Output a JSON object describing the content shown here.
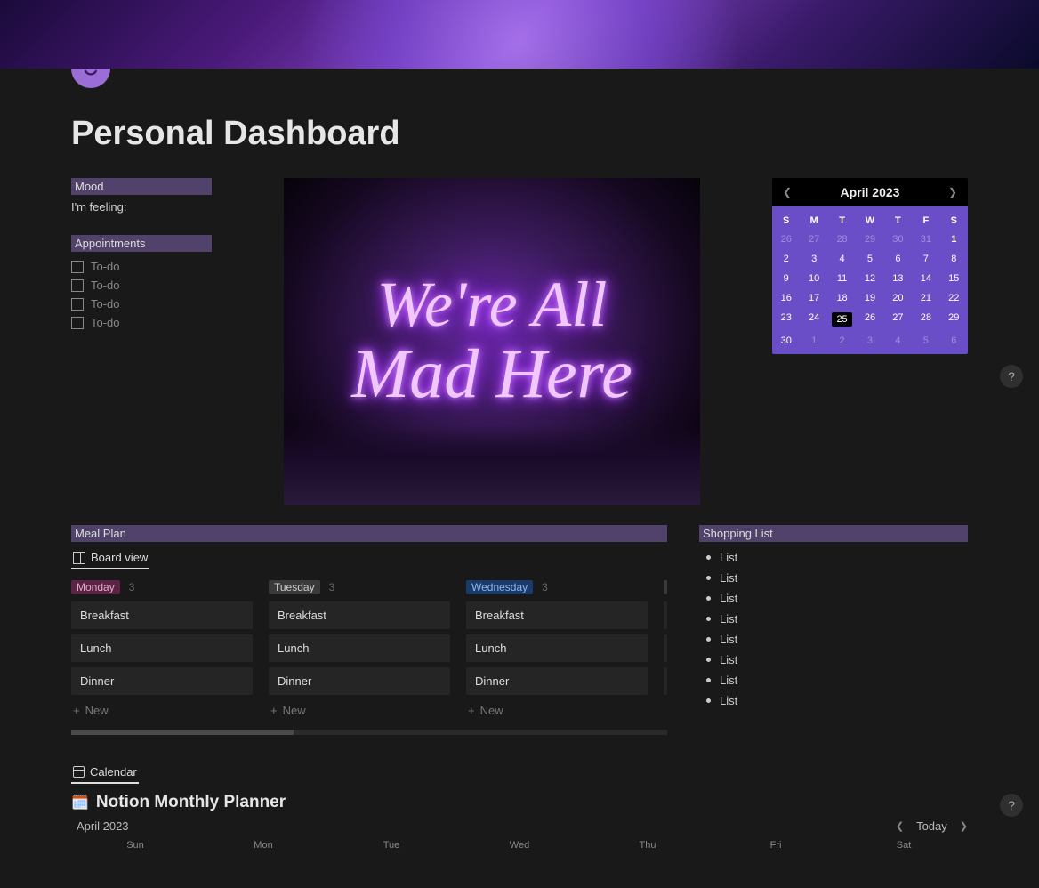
{
  "page": {
    "title": "Personal Dashboard",
    "help_label": "?"
  },
  "mood": {
    "heading": "Mood",
    "text": "I'm feeling:"
  },
  "appointments": {
    "heading": "Appointments",
    "items": [
      "To-do",
      "To-do",
      "To-do",
      "To-do"
    ]
  },
  "neon": {
    "line1": "We're All",
    "line2": "Mad Here"
  },
  "mini_calendar": {
    "title": "April 2023",
    "dow": [
      "S",
      "M",
      "T",
      "W",
      "T",
      "F",
      "S"
    ],
    "weeks": [
      [
        {
          "d": "26",
          "off": true
        },
        {
          "d": "27",
          "off": true
        },
        {
          "d": "28",
          "off": true
        },
        {
          "d": "29",
          "off": true
        },
        {
          "d": "30",
          "off": true
        },
        {
          "d": "31",
          "off": true
        },
        {
          "d": "1",
          "bold": true
        }
      ],
      [
        {
          "d": "2"
        },
        {
          "d": "3"
        },
        {
          "d": "4"
        },
        {
          "d": "5"
        },
        {
          "d": "6"
        },
        {
          "d": "7"
        },
        {
          "d": "8"
        }
      ],
      [
        {
          "d": "9"
        },
        {
          "d": "10"
        },
        {
          "d": "11"
        },
        {
          "d": "12"
        },
        {
          "d": "13"
        },
        {
          "d": "14"
        },
        {
          "d": "15"
        }
      ],
      [
        {
          "d": "16"
        },
        {
          "d": "17"
        },
        {
          "d": "18"
        },
        {
          "d": "19"
        },
        {
          "d": "20"
        },
        {
          "d": "21"
        },
        {
          "d": "22"
        }
      ],
      [
        {
          "d": "23"
        },
        {
          "d": "24"
        },
        {
          "d": "25",
          "sel": true
        },
        {
          "d": "26"
        },
        {
          "d": "27"
        },
        {
          "d": "28"
        },
        {
          "d": "29"
        }
      ],
      [
        {
          "d": "30"
        },
        {
          "d": "1",
          "off": true
        },
        {
          "d": "2",
          "off": true
        },
        {
          "d": "3",
          "off": true
        },
        {
          "d": "4",
          "off": true
        },
        {
          "d": "5",
          "off": true
        },
        {
          "d": "6",
          "off": true
        }
      ]
    ]
  },
  "meal_plan": {
    "heading": "Meal Plan",
    "view_label": "Board view",
    "new_label": "New",
    "columns": [
      {
        "tag": "Monday",
        "cls": "mon",
        "count": "3",
        "cards": [
          "Breakfast",
          "Lunch",
          "Dinner"
        ]
      },
      {
        "tag": "Tuesday",
        "cls": "tue",
        "count": "3",
        "cards": [
          "Breakfast",
          "Lunch",
          "Dinner"
        ]
      },
      {
        "tag": "Wednesday",
        "cls": "wed",
        "count": "3",
        "cards": [
          "Breakfast",
          "Lunch",
          "Dinner"
        ]
      }
    ]
  },
  "shopping": {
    "heading": "Shopping List",
    "items": [
      "List",
      "List",
      "List",
      "List",
      "List",
      "List",
      "List",
      "List"
    ]
  },
  "monthly": {
    "view_label": "Calendar",
    "title": "Notion Monthly Planner",
    "month": "April 2023",
    "today_label": "Today",
    "dow": [
      "Sun",
      "Mon",
      "Tue",
      "Wed",
      "Thu",
      "Fri",
      "Sat"
    ]
  }
}
